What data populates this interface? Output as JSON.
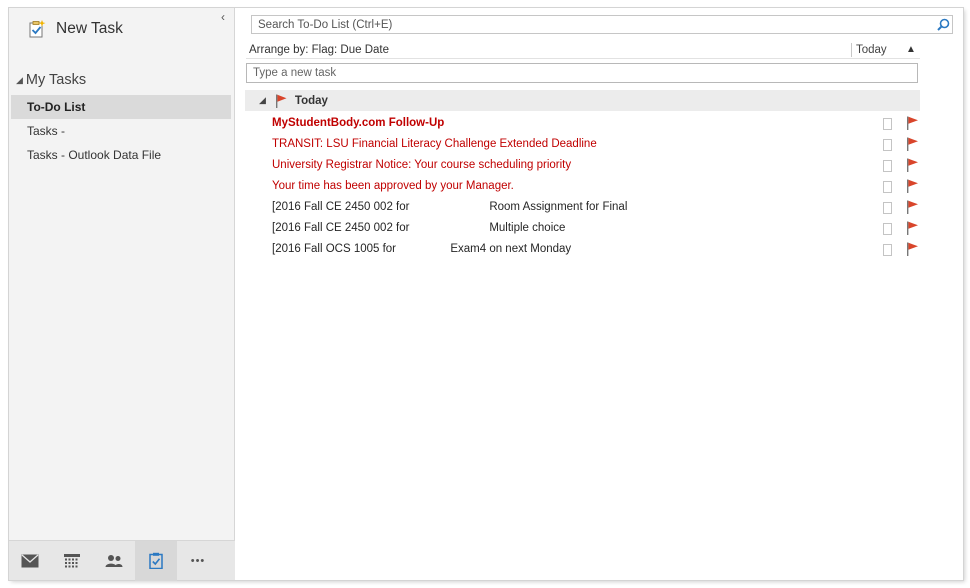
{
  "sidebar": {
    "new_task_label": "New Task",
    "collapse_glyph": "‹",
    "my_tasks_label": "My Tasks",
    "folders": [
      {
        "label": "To-Do List",
        "selected": true
      },
      {
        "label": "Tasks -",
        "selected": false
      },
      {
        "label": "Tasks - Outlook Data File",
        "selected": false
      }
    ],
    "nav_icons": [
      "mail-icon",
      "calendar-icon",
      "people-icon",
      "tasks-icon",
      "more-icon"
    ],
    "more_glyph": "•••"
  },
  "main": {
    "search_placeholder": "Search To-Do List (Ctrl+E)",
    "arrange_label": "Arrange by: Flag: Due Date",
    "arrange_today": "Today",
    "new_task_placeholder": "Type a new task",
    "group_label": "Today",
    "tasks": [
      {
        "subject": "MyStudentBody.com Follow-Up",
        "overdue": true,
        "bold": true
      },
      {
        "subject": "TRANSIT: LSU Financial Literacy Challenge Extended Deadline",
        "overdue": true,
        "bold": false
      },
      {
        "subject": "University Registrar Notice: Your course scheduling priority",
        "overdue": true,
        "bold": false
      },
      {
        "subject": "Your time has been approved by your Manager.",
        "overdue": true,
        "bold": false
      },
      {
        "subject": "[2016 Fall CE 2450 002 for                         Room Assignment for Final",
        "overdue": false,
        "bold": false
      },
      {
        "subject": "[2016 Fall CE 2450 002 for                         Multiple choice",
        "overdue": false,
        "bold": false
      },
      {
        "subject": "[2016 Fall OCS 1005 for                 Exam4 on next Monday",
        "overdue": false,
        "bold": false
      }
    ]
  },
  "colors": {
    "accent": "#2b79c2",
    "flag_red": "#d9452b",
    "overdue_text": "#c00000"
  }
}
